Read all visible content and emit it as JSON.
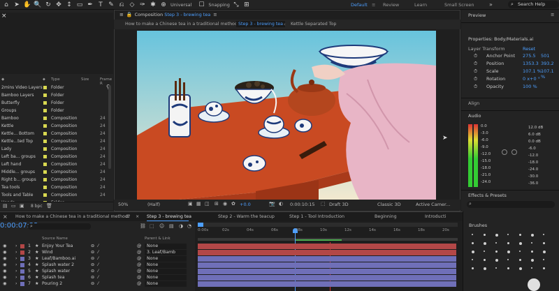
{
  "toolbar": {
    "universal_label": "Universal",
    "snapping_label": "Snapping",
    "workspaces": [
      "Default",
      "Review",
      "Learn",
      "Small Screen"
    ],
    "active_workspace": "Default",
    "search_help": "Search Help"
  },
  "project": {
    "columns": [
      "Type",
      "Size",
      "Frame R"
    ],
    "items": [
      {
        "name": "2mins Video Layers",
        "type": "Folder",
        "size": ""
      },
      {
        "name": "Bamboo Layers",
        "type": "Folder",
        "size": ""
      },
      {
        "name": "Butterfly",
        "type": "Folder",
        "size": ""
      },
      {
        "name": "Groups",
        "type": "Folder",
        "size": ""
      },
      {
        "name": "Bamboo",
        "type": "Composition",
        "size": "24"
      },
      {
        "name": "Kettle",
        "type": "Composition",
        "size": "24"
      },
      {
        "name": "Kettle... Bottom",
        "type": "Composition",
        "size": "24"
      },
      {
        "name": "Kettle...ted Top",
        "type": "Composition",
        "size": "24"
      },
      {
        "name": "Lady",
        "type": "Composition",
        "size": "24"
      },
      {
        "name": "Left ba... groups",
        "type": "Composition",
        "size": "24"
      },
      {
        "name": "Left hand",
        "type": "Composition",
        "size": "24"
      },
      {
        "name": "Middle... groups",
        "type": "Composition",
        "size": "24"
      },
      {
        "name": "Right b... groups",
        "type": "Composition",
        "size": "24"
      },
      {
        "name": "Tea tools",
        "type": "Composition",
        "size": "24"
      },
      {
        "name": "Tools and Table",
        "type": "Composition",
        "size": "24"
      },
      {
        "name": "Hands",
        "type": "Folder",
        "size": ""
      }
    ],
    "bpc": "8 bpc"
  },
  "composition": {
    "panel_label": "Composition",
    "panel_name": "Step 3 - brewing tea",
    "nav": [
      "How to make a Chinese tea in a traditional method?",
      "Step 3 - brewing tea",
      "Kettle Separated Top"
    ],
    "active_nav": "Step 3 - brewing tea",
    "zoom": "50%",
    "resolution": "(Half)",
    "exposure": "+0.0",
    "timecode": "0:00:10:15",
    "renderer": "Draft 3D",
    "renderer_mode": "Classic 3D",
    "camera": "Active Camer..."
  },
  "properties": {
    "header": "Preview",
    "title": "Properties: Body/Materials.ai",
    "section": "Layer Transform",
    "reset": "Reset",
    "rows": [
      {
        "label": "Anchor Point",
        "v1": "275.5",
        "v2": "501"
      },
      {
        "label": "Position",
        "v1": "1353.3",
        "v2": "393.2"
      },
      {
        "label": "Scale",
        "v1": "107.1 %",
        "v2": "107.1 %"
      },
      {
        "label": "Rotation",
        "v1": "0 x+0 °",
        "v2": ""
      },
      {
        "label": "Opacity",
        "v1": "100 %",
        "v2": ""
      }
    ],
    "align": "Align",
    "audio": "Audio",
    "audio_levels_left": [
      "0.0",
      "-3.0",
      "-6.0",
      "-9.0",
      "-12.0",
      "-15.0",
      "-18.0",
      "-21.0",
      "-24.0"
    ],
    "audio_levels_right": [
      "12.0 dB",
      "6.0 dB",
      "0.0 dB",
      "-6.0",
      "-12.0",
      "-18.0",
      "-24.0",
      "-30.0",
      "-36.0"
    ],
    "effects": "Effects & Presets"
  },
  "timeline": {
    "tabs": [
      "How to make a Chinese tea in a traditional method?",
      "Step 3 - brewing tea",
      "Step 2 - Warm the teacup",
      "Step 1 - Tool Introduction",
      "Beginning",
      "Introducti"
    ],
    "active_tab": "Step 3 - brewing tea",
    "current_time": "0:00:07:22",
    "columns": {
      "source": "Source Name",
      "parent": "Parent & Link"
    },
    "ruler": [
      "0:00s",
      "02s",
      "04s",
      "06s",
      "08s",
      "10s",
      "12s",
      "14s",
      "16s",
      "18s",
      "20s"
    ],
    "layers": [
      {
        "num": "1",
        "name": "Enjoy Your Tea",
        "parent": "None",
        "color": "#b34747"
      },
      {
        "num": "2",
        "name": "Wind",
        "parent": "3. Leaf/Bamb",
        "color": "#b34747"
      },
      {
        "num": "3",
        "name": "Leaf/Bamboo.ai",
        "parent": "None",
        "color": "#6f6fb8"
      },
      {
        "num": "4",
        "name": "Splash water 2",
        "parent": "None",
        "color": "#6f6fb8"
      },
      {
        "num": "5",
        "name": "Splash water",
        "parent": "None",
        "color": "#6f6fb8"
      },
      {
        "num": "6",
        "name": "Splash tea",
        "parent": "None",
        "color": "#6f6fb8"
      },
      {
        "num": "7",
        "name": "Pouring 2",
        "parent": "None",
        "color": "#6f6fb8"
      }
    ]
  },
  "brushes": {
    "title": "Brushes"
  },
  "colors": {
    "accent": "#4d9fff",
    "sky": "#8fd3e3",
    "table": "#c94a22",
    "pink": "#e8b5c6"
  }
}
